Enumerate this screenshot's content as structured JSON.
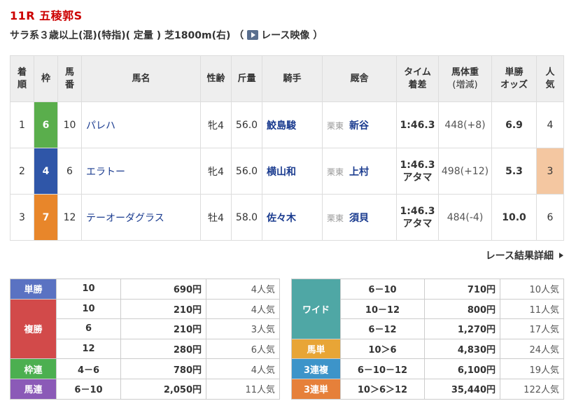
{
  "race": {
    "title": "11R 五稜郭S",
    "conditions_prefix": "サラ系３歳以上(混)(特指)( 定量 ) 芝1800m(右) （",
    "video_label": "レース映像",
    "conditions_suffix": "）"
  },
  "headers": {
    "rank": "着順",
    "waku": "枠",
    "number": "馬番",
    "horse": "馬名",
    "sex_age": "性齢",
    "weight_carried": "斤量",
    "jockey": "騎手",
    "trainer": "厩舎",
    "time": "タイム着差",
    "body_weight": "馬体重(増減)",
    "odds": "単勝オッズ",
    "popularity": "人気"
  },
  "results": [
    {
      "rank": "1",
      "waku": "6",
      "waku_color": "#5aae4c",
      "number": "10",
      "horse": "パレハ",
      "sex_age": "牝4",
      "kinryo": "56.0",
      "jockey": "鮫島駿",
      "region": "栗東",
      "trainer": "新谷",
      "time": "1:46.3",
      "margin": "",
      "body_weight": "448(+8)",
      "odds": "6.9",
      "popularity": "4"
    },
    {
      "rank": "2",
      "waku": "4",
      "waku_color": "#2f56a8",
      "number": "6",
      "horse": "エラトー",
      "sex_age": "牝4",
      "kinryo": "56.0",
      "jockey": "横山和",
      "region": "栗東",
      "trainer": "上村",
      "time": "1:46.3",
      "margin": "アタマ",
      "body_weight": "498(+12)",
      "odds": "5.3",
      "popularity": "3"
    },
    {
      "rank": "3",
      "waku": "7",
      "waku_color": "#e8862a",
      "number": "12",
      "horse": "テーオーダグラス",
      "sex_age": "牡4",
      "kinryo": "58.0",
      "jockey": "佐々木",
      "region": "栗東",
      "trainer": "須貝",
      "time": "1:46.3",
      "margin": "アタマ",
      "body_weight": "484(-4)",
      "odds": "10.0",
      "popularity": "6"
    }
  ],
  "detail_link": "レース結果詳細",
  "payouts_left": {
    "tansho": {
      "label": "単勝",
      "rows": [
        {
          "combo": "10",
          "amount": "690円",
          "pop": "4人気"
        }
      ]
    },
    "fukusho": {
      "label": "複勝",
      "rows": [
        {
          "combo": "10",
          "amount": "210円",
          "pop": "4人気"
        },
        {
          "combo": "6",
          "amount": "210円",
          "pop": "3人気"
        },
        {
          "combo": "12",
          "amount": "280円",
          "pop": "6人気"
        }
      ]
    },
    "wakuren": {
      "label": "枠連",
      "rows": [
        {
          "combo": "4－6",
          "amount": "780円",
          "pop": "4人気"
        }
      ]
    },
    "umaren": {
      "label": "馬連",
      "rows": [
        {
          "combo": "6－10",
          "amount": "2,050円",
          "pop": "11人気"
        }
      ]
    }
  },
  "payouts_right": {
    "wide": {
      "label": "ワイド",
      "rows": [
        {
          "combo": "6－10",
          "amount": "710円",
          "pop": "10人気"
        },
        {
          "combo": "10－12",
          "amount": "800円",
          "pop": "11人気"
        },
        {
          "combo": "6－12",
          "amount": "1,270円",
          "pop": "17人気"
        }
      ]
    },
    "umatan": {
      "label": "馬単",
      "rows": [
        {
          "combo": "10＞6",
          "amount": "4,830円",
          "pop": "24人気"
        }
      ]
    },
    "sanrenpuku": {
      "label": "3連複",
      "rows": [
        {
          "combo": "6－10－12",
          "amount": "6,100円",
          "pop": "19人気"
        }
      ]
    },
    "sanrentan": {
      "label": "3連単",
      "rows": [
        {
          "combo": "10＞6＞12",
          "amount": "35,440円",
          "pop": "122人気"
        }
      ]
    }
  }
}
